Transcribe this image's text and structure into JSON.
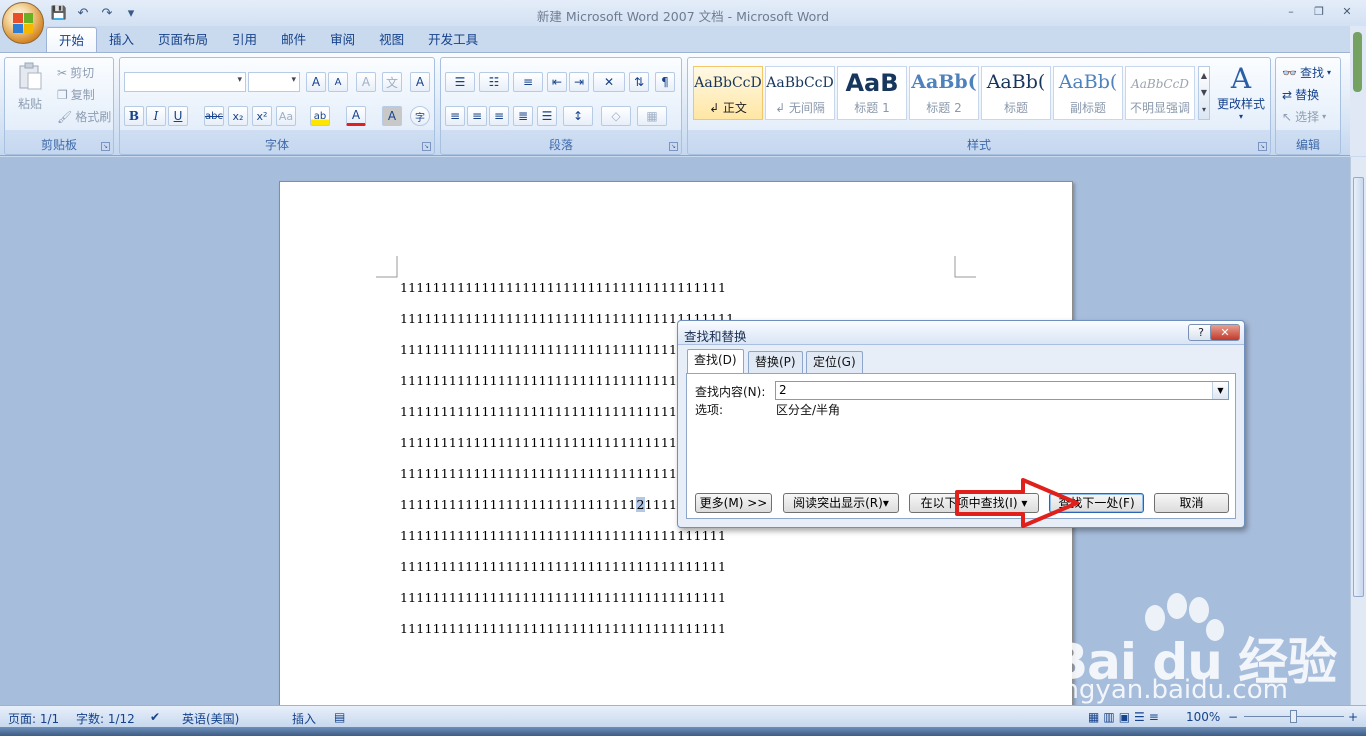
{
  "window": {
    "title": "新建 Microsoft Word 2007 文档 - Microsoft Word",
    "controls": [
      "–",
      "❐",
      "✕"
    ]
  },
  "quick_access": {
    "icons": [
      "save-icon",
      "undo-icon",
      "redo-icon",
      "customize-icon"
    ],
    "glyphs": [
      "💾",
      "↶",
      "↷",
      "▾"
    ]
  },
  "tabs": [
    {
      "label": "开始",
      "active": true
    },
    {
      "label": "插入"
    },
    {
      "label": "页面布局"
    },
    {
      "label": "引用"
    },
    {
      "label": "邮件"
    },
    {
      "label": "审阅"
    },
    {
      "label": "视图"
    },
    {
      "label": "开发工具"
    }
  ],
  "ribbon": {
    "clipboard": {
      "label": "剪贴板",
      "paste": "粘贴",
      "cut": "剪切",
      "copy": "复制",
      "format_painter": "格式刷"
    },
    "font": {
      "label": "字体",
      "bold": "B",
      "italic": "I",
      "underline": "U",
      "strike": "abc",
      "sub": "x₂",
      "sup": "x²",
      "case": "Aa",
      "grow": "A",
      "shrink": "A",
      "clear": "A",
      "phonetic": "A",
      "highlight": "ab",
      "color": "A",
      "shading": "A",
      "enclose": "字",
      "phonetic_text": "文"
    },
    "paragraph": {
      "label": "段落"
    },
    "styles": {
      "label": "样式",
      "items": [
        {
          "sample": "AaBbCcD",
          "name": "↲ 正文",
          "selected": true,
          "size": 14
        },
        {
          "sample": "AaBbCcD",
          "name": "↲ 无间隔",
          "size": 14
        },
        {
          "sample": "AaB",
          "name": "标题 1",
          "size": 24
        },
        {
          "sample": "AaBb(",
          "name": "标题 2",
          "size": 19
        },
        {
          "sample": "AaBb(",
          "name": "标题",
          "size": 19
        },
        {
          "sample": "AaBb(",
          "name": "副标题",
          "size": 19
        },
        {
          "sample": "AaBbCcD",
          "name": "不明显强调",
          "size": 12
        }
      ],
      "change_styles": "更改样式"
    },
    "editing": {
      "label": "编辑",
      "find": "查找",
      "replace": "替换",
      "select": "选择"
    }
  },
  "document": {
    "lines": [
      "1111111111111111111111111111111111111111",
      "11111111111111111111111111111111111111111",
      "111111111111111111111111111111111111111",
      "1111111111111111111111111111111111111111",
      "1111111111111111111111111111111111111111",
      "1111111111111111111111111111111111111111",
      "1111111111111111111111111111111111111111",
      {
        "before": "11111111111111111111111111111",
        "match": "2",
        "after": "1111111111"
      },
      "1111111111111111111111111111111111111111",
      "1111111111111111111111111111111111111111",
      "1111111111111111111111111111111111111111",
      "1111111111111111111111111111111111111111"
    ]
  },
  "dialog": {
    "title": "查找和替换",
    "help": "?",
    "close": "✕",
    "tabs": [
      {
        "label": "查找(D)",
        "active": true
      },
      {
        "label": "替换(P)"
      },
      {
        "label": "定位(G)"
      }
    ],
    "find_label": "查找内容(N):",
    "find_value": "2",
    "options_label": "选项:",
    "options_value": "区分全/半角",
    "buttons": {
      "more": "更多(M) >>",
      "reading_highlight": "阅读突出显示(R)▾",
      "find_in": "在以下项中查找(I) ▾",
      "find_next": "查找下一处(F)",
      "cancel": "取消"
    }
  },
  "status_bar": {
    "page": "页面: 1/1",
    "words": "字数: 1/12",
    "language": "英语(美国)",
    "mode": "插入",
    "zoom": "100%",
    "zoom_minus": "−",
    "zoom_plus": "+"
  },
  "watermark": {
    "brand": "Bai du 经验",
    "url": "jingyan.baidu.com"
  },
  "colors": {
    "accent": "#15428b",
    "arrow": "#e0201b",
    "highlight": "#b2c8e6"
  }
}
